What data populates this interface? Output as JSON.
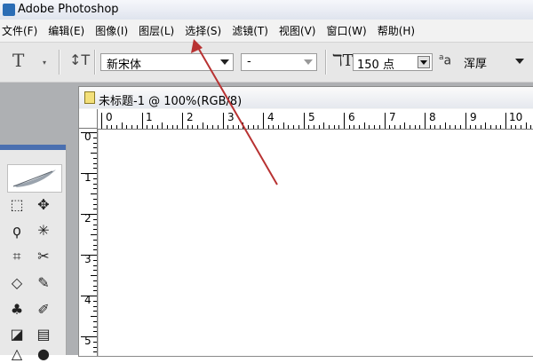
{
  "window": {
    "title": "Adobe Photoshop"
  },
  "menu": [
    {
      "label": "文件(F)"
    },
    {
      "label": "编辑(E)"
    },
    {
      "label": "图像(I)"
    },
    {
      "label": "图层(L)"
    },
    {
      "label": "选择(S)"
    },
    {
      "label": "滤镜(T)"
    },
    {
      "label": "视图(V)"
    },
    {
      "label": "窗口(W)"
    },
    {
      "label": "帮助(H)"
    }
  ],
  "options": {
    "tool_preset_icon": "text-tool-icon",
    "orientation_icon": "text-orientation-icon",
    "font_family": "新宋体",
    "font_style": "-",
    "font_size_icon": "font-size-icon",
    "font_size": "150 点",
    "antialias_icon": "antialias-icon",
    "antialias_label": "a",
    "antialias": "浑厚"
  },
  "toolbox": {
    "tools": [
      {
        "icon": "marquee-icon",
        "glyph": "⬚"
      },
      {
        "icon": "move-icon",
        "glyph": "✥"
      },
      {
        "icon": "lasso-icon",
        "glyph": "ϙ"
      },
      {
        "icon": "magic-wand-icon",
        "glyph": "✳"
      },
      {
        "icon": "crop-icon",
        "glyph": "⌗"
      },
      {
        "icon": "slice-icon",
        "glyph": "✂"
      },
      {
        "icon": "healing-brush-icon",
        "glyph": "◇"
      },
      {
        "icon": "brush-icon",
        "glyph": "✎"
      },
      {
        "icon": "clone-stamp-icon",
        "glyph": "♣"
      },
      {
        "icon": "history-brush-icon",
        "glyph": "✐"
      },
      {
        "icon": "eraser-icon",
        "glyph": "◪"
      },
      {
        "icon": "gradient-icon",
        "glyph": "▤"
      },
      {
        "icon": "pen-icon",
        "glyph": "△"
      },
      {
        "icon": "burn-icon",
        "glyph": "●"
      }
    ]
  },
  "document": {
    "title": "未标题-1 @ 100%(RGB/8)",
    "ruler_h": [
      "0",
      "1",
      "2",
      "3",
      "4",
      "5",
      "6",
      "7",
      "8",
      "9",
      "10"
    ],
    "ruler_v": [
      "0",
      "1",
      "2",
      "3",
      "4",
      "5"
    ]
  },
  "colors": {
    "annotation_arrow": "#b83232",
    "title_gradient_end": "#dfe4ee"
  }
}
